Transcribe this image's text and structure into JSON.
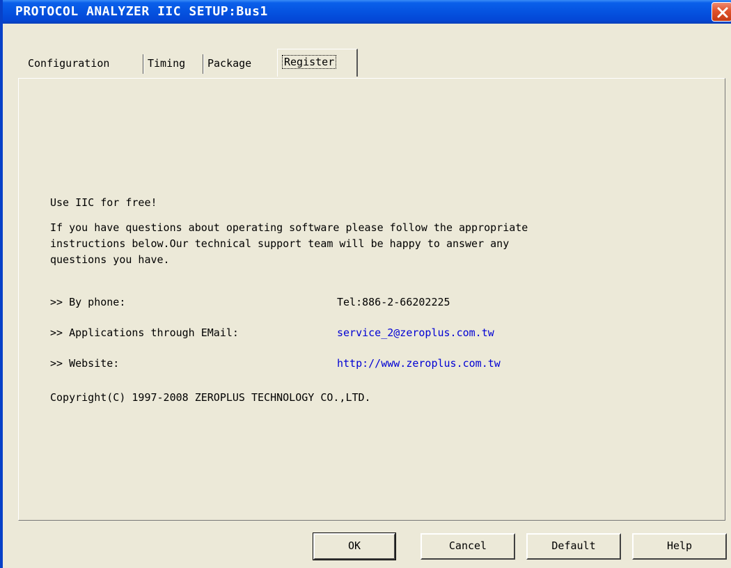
{
  "window": {
    "title": "PROTOCOL ANALYZER IIC SETUP:Bus1"
  },
  "tabs": [
    {
      "label": "Configuration",
      "active": false
    },
    {
      "label": "Timing",
      "active": false
    },
    {
      "label": "Package",
      "active": false
    },
    {
      "label": "Register",
      "active": true
    }
  ],
  "register": {
    "headline": "Use IIC for free!",
    "intro_lines": [
      "If you have questions about operating software please follow the appropriate",
      "instructions below.Our technical support team will be happy to answer any",
      "questions you have."
    ],
    "contacts": [
      {
        "label": ">> By phone:",
        "value": "Tel:886-2-66202225",
        "is_link": false
      },
      {
        "label": ">> Applications through EMail:",
        "value": "service_2@zeroplus.com.tw",
        "is_link": true
      },
      {
        "label": ">> Website:",
        "value": "http://www.zeroplus.com.tw",
        "is_link": true
      }
    ],
    "copyright": "Copyright(C) 1997-2008 ZEROPLUS TECHNOLOGY CO.,LTD."
  },
  "buttons": {
    "ok": "OK",
    "cancel": "Cancel",
    "default": "Default",
    "help": "Help"
  },
  "colors": {
    "title_bar": "#0553e0",
    "dialog_bg": "#ece9d8",
    "link": "#0000d4",
    "close_button": "#e0522b"
  }
}
